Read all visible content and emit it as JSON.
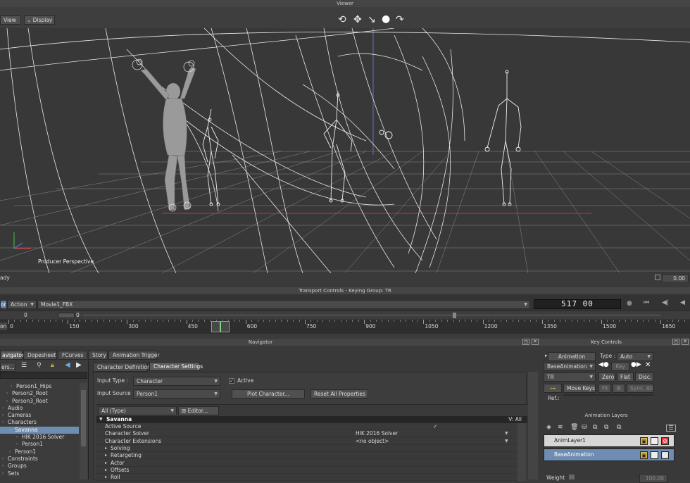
{
  "viewer": {
    "title": "Viewer",
    "menu_view": "View",
    "menu_display": "Display",
    "perspective_label": "Producer Perspective",
    "status": "ady",
    "coord_value": "0.00"
  },
  "transport": {
    "title": "Transport Controls  -  Keying Group: TR",
    "mode_left": "ory",
    "mode_action": "Action",
    "take": "Movie1_FBX",
    "frame_display": "517 00",
    "range_start": "0",
    "range_cursor": "0",
    "ruler_start": "on",
    "ruler_labels": [
      "0",
      "150",
      "300",
      "450",
      "600",
      "750",
      "900",
      "1050",
      "1200",
      "1350",
      "1500",
      "1650"
    ]
  },
  "navigator": {
    "title": "Navigator",
    "tabs": [
      "avigator",
      "Dopesheet",
      "FCurves",
      "Story",
      "Animation Trigger"
    ],
    "filter_label": "ers...",
    "tree": [
      {
        "label": "Person1_Hips",
        "indent": 14,
        "selected": false
      },
      {
        "label": "Person2_Root",
        "indent": 8,
        "selected": false
      },
      {
        "label": "Person3_Root",
        "indent": 8,
        "selected": false
      },
      {
        "label": "Audio",
        "indent": 2,
        "selected": false
      },
      {
        "label": "Cameras",
        "indent": 2,
        "selected": false
      },
      {
        "label": "Characters",
        "indent": 2,
        "selected": false
      },
      {
        "label": "Savanna",
        "indent": 12,
        "selected": true
      },
      {
        "label": "HIK 2016 Solver",
        "indent": 22,
        "selected": false
      },
      {
        "label": "Person1",
        "indent": 22,
        "selected": false
      },
      {
        "label": "Person1",
        "indent": 12,
        "selected": false
      },
      {
        "label": "Constraints",
        "indent": 2,
        "selected": false
      },
      {
        "label": "Groups",
        "indent": 2,
        "selected": false
      },
      {
        "label": "Sets",
        "indent": 2,
        "selected": false
      }
    ]
  },
  "character": {
    "tab_definition": "Character Definition",
    "tab_settings": "Character Settings",
    "input_type_label": "Input Type :",
    "input_type_value": "Character",
    "active_label": "Active",
    "input_source_label": "Input Source :",
    "input_source_value": "Person1",
    "plot_button": "Plot Character...",
    "reset_button": "Reset All Properties",
    "filter_type": "All (Type)",
    "editor_button": "Editor...",
    "group_name": "Savanna",
    "group_right": "V: All",
    "props": [
      {
        "label": "Active Source",
        "value": "✓",
        "indent": 12,
        "arrow": ""
      },
      {
        "label": "Character Solver",
        "value": "HIK 2016 Solver",
        "indent": 12,
        "arrow": ""
      },
      {
        "label": "Character Extensions",
        "value": "<no object>",
        "indent": 12,
        "arrow": ""
      },
      {
        "label": "Solving",
        "value": "",
        "indent": 20,
        "arrow": "▸"
      },
      {
        "label": "Retargeting",
        "value": "",
        "indent": 20,
        "arrow": "▸"
      },
      {
        "label": "Actor",
        "value": "",
        "indent": 20,
        "arrow": "▸"
      },
      {
        "label": "Offsets",
        "value": "",
        "indent": 20,
        "arrow": "▸"
      },
      {
        "label": "Roll",
        "value": "",
        "indent": 20,
        "arrow": "▸"
      }
    ]
  },
  "key_controls": {
    "title": "Key Controls",
    "animation_button": "Animation",
    "type_label": "Type :",
    "type_value": "Auto",
    "layer_select": "BaseAnimation",
    "key_button": "Key",
    "group_select": "TR",
    "zero": "Zero",
    "flat": "Flat",
    "disc": "Disc.",
    "move_keys": "Move Keys",
    "fk": "FK",
    "ik": "IK",
    "sync_all": "Sync. All",
    "ref_label": "Ref.:"
  },
  "anim_layers": {
    "title": "Animation Layers",
    "layers": [
      {
        "name": "AnimLayer1",
        "selected": false
      },
      {
        "name": "BaseAnimation",
        "selected": true
      }
    ],
    "weight_label": "Weight",
    "weight_value": "100.00"
  }
}
